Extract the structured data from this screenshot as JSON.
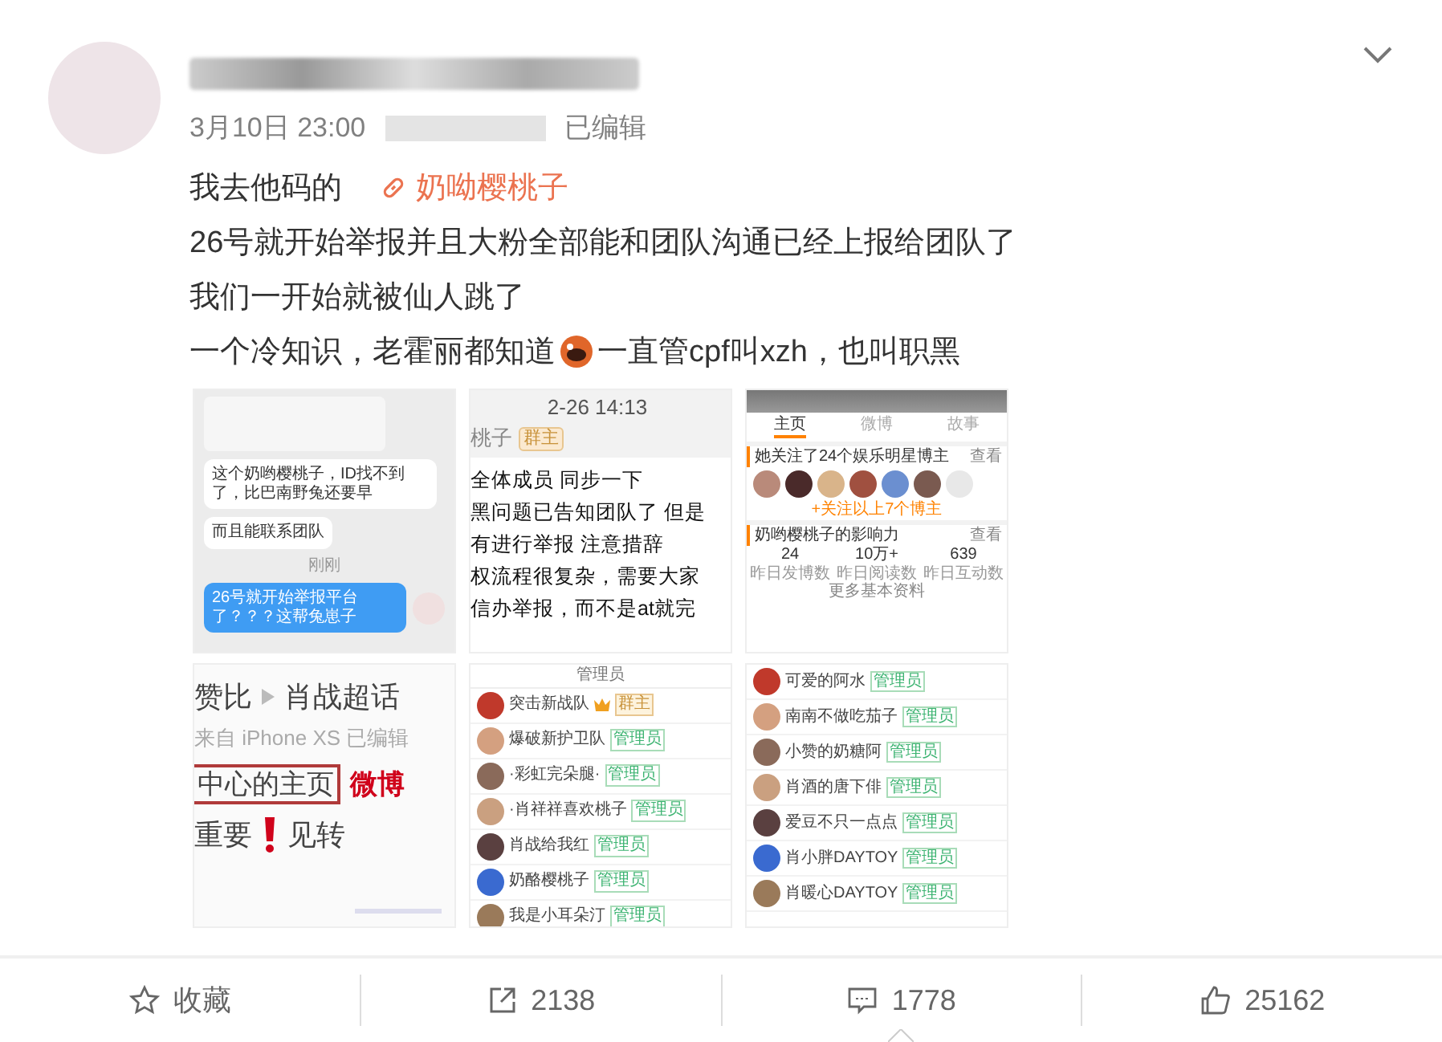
{
  "post": {
    "timestamp": "3月10日 23:00",
    "edited_label": "已编辑",
    "text_lines": [
      {
        "kind": "link_line",
        "text": "我去他码的",
        "link": "奶呦樱桃子"
      },
      {
        "kind": "plain",
        "text": "26号就开始举报并且大粉全部能和团队沟通已经上报给团队了"
      },
      {
        "kind": "plain",
        "text": "我们一开始就被仙人跳了"
      },
      {
        "kind": "emoji_line",
        "before": "一个冷知识，老霍丽都知道",
        "after": "一直管cpf叫xzh，也叫职黑"
      }
    ]
  },
  "images": [
    {
      "kind": "chat",
      "messages": [
        {
          "kind": "left",
          "text": "这个奶哟樱桃子，ID找不到了，比巴南野兔还要早"
        },
        {
          "kind": "left",
          "text": "而且能联系团队"
        },
        {
          "kind": "time",
          "text": "刚刚"
        },
        {
          "kind": "right",
          "text": "26号就开始举报平台了？？？这帮兔崽子"
        }
      ]
    },
    {
      "kind": "notice",
      "time": "2-26 14:13",
      "sender": "桃子",
      "badge": "群主",
      "lines": [
        "全体成员 同步一下",
        "黑问题已告知团队了 但是",
        "有进行举报 注意措辞",
        "权流程很复杂，需要大家",
        "信办举报，而不是at就完"
      ]
    },
    {
      "kind": "profile",
      "tabs": [
        {
          "label": "主页",
          "selected": true
        },
        {
          "label": "微博",
          "selected": false
        },
        {
          "label": "故事",
          "selected": false
        }
      ],
      "follow_title": "她关注了24个娱乐明星博主",
      "follow_more": "查看",
      "follow_button": "+关注以上7个博主",
      "influence_title": "奶哟樱桃子的影响力",
      "influence_more": "查看",
      "stats": [
        {
          "value": "24",
          "label": "昨日发博数"
        },
        {
          "value": "10万+",
          "label": "昨日阅读数"
        },
        {
          "value": "639",
          "label": "昨日互动数"
        }
      ],
      "footer": "更多基本资料"
    },
    {
      "kind": "snippet",
      "breadcrumb_from": "赞比",
      "breadcrumb_to": "肖战超话",
      "source": "来自 iPhone XS 已编辑",
      "boxed": "中心的主页",
      "brand": "微博",
      "line_before": "重要",
      "line_after": "见转"
    },
    {
      "kind": "members",
      "title": "管理员",
      "members": [
        {
          "name": "突击新战队",
          "badge": "群主",
          "owner": true
        },
        {
          "name": "爆破新护卫队",
          "badge": "管理员",
          "owner": false
        },
        {
          "name": "·彩虹完朵腿·",
          "badge": "管理员",
          "owner": false
        },
        {
          "name": "·肖祥祥喜欢桃子",
          "badge": "管理员",
          "owner": false
        },
        {
          "name": "肖战给我红",
          "badge": "管理员",
          "owner": false
        },
        {
          "name": "奶酪樱桃子",
          "badge": "管理员",
          "owner": false
        },
        {
          "name": "我是小耳朵汀",
          "badge": "管理员",
          "owner": false
        }
      ]
    },
    {
      "kind": "members",
      "members": [
        {
          "name": "可爱的阿水",
          "badge": "管理员",
          "owner": false
        },
        {
          "name": "南南不做吃茄子",
          "badge": "管理员",
          "owner": false
        },
        {
          "name": "小赞的奶糖阿",
          "badge": "管理员",
          "owner": false
        },
        {
          "name": "肖酒的唐下俳",
          "badge": "管理员",
          "owner": false
        },
        {
          "name": "爱豆不只一点点",
          "badge": "管理员",
          "owner": false
        },
        {
          "name": "肖小胖DAYTOY",
          "badge": "管理员",
          "owner": false
        },
        {
          "name": "肖暖心DAYTOY",
          "badge": "管理员",
          "owner": false
        }
      ]
    }
  ],
  "actions": [
    {
      "kind": "favorite",
      "label": "收藏",
      "selected": false
    },
    {
      "kind": "repost",
      "label": "2138",
      "selected": false
    },
    {
      "kind": "comment",
      "label": "1778",
      "selected": true
    },
    {
      "kind": "like",
      "label": "25162",
      "selected": false
    }
  ]
}
